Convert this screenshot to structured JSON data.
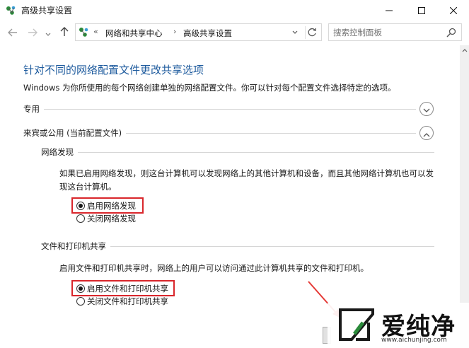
{
  "window": {
    "title": "高级共享设置"
  },
  "nav": {
    "crumb_chevrons": "«",
    "crumb_sep": "›",
    "breadcrumb": [
      "网络和共享中心",
      "高级共享设置"
    ]
  },
  "search": {
    "placeholder": "搜索控制面板"
  },
  "page": {
    "title": "针对不同的网络配置文件更改共享选项",
    "description": "Windows 为你所使用的每个网络创建单独的网络配置文件。你可以针对每个配置文件选择特定的选项。"
  },
  "profiles": {
    "private": {
      "label": "专用",
      "expanded": false
    },
    "guest_public": {
      "label": "来宾或公用 (当前配置文件)",
      "expanded": true
    }
  },
  "network_discovery": {
    "heading": "网络发现",
    "description": "如果已启用网络发现，则这台计算机可以发现网络上的其他计算机和设备，而且其他网络计算机也可以发现这台计算机。",
    "options": [
      {
        "label": "启用网络发现",
        "selected": true
      },
      {
        "label": "关闭网络发现",
        "selected": false
      }
    ]
  },
  "file_printer_sharing": {
    "heading": "文件和打印机共享",
    "description": "启用文件和打印机共享时，网络上的用户可以访问通过此计算机共享的文件和打印机。",
    "options": [
      {
        "label": "启用文件和打印机共享",
        "selected": true
      },
      {
        "label": "关闭文件和打印机共享",
        "selected": false
      }
    ]
  },
  "watermark": {
    "text": "爱纯净",
    "url": "www.aichunjing.com"
  },
  "colors": {
    "title_blue": "#1e5b9e",
    "highlight_red": "#d9262b",
    "watermark_green": "#2a8a3a"
  }
}
